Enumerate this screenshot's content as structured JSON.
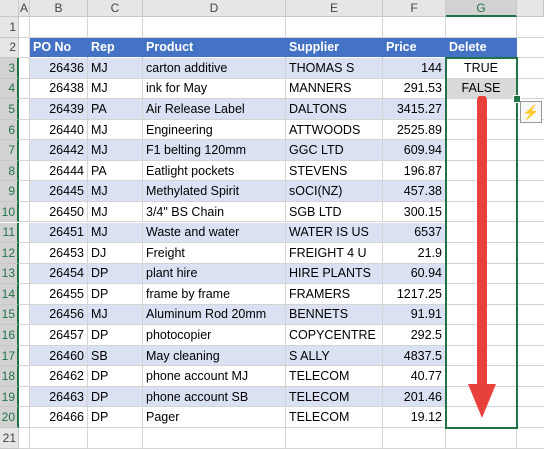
{
  "columns": [
    "A",
    "B",
    "C",
    "D",
    "E",
    "F",
    "G"
  ],
  "selected_column": "G",
  "rows": [
    "1",
    "2",
    "3",
    "4",
    "5",
    "6",
    "7",
    "8",
    "9",
    "10",
    "11",
    "12",
    "13",
    "14",
    "15",
    "16",
    "17",
    "18",
    "19",
    "20",
    "21"
  ],
  "headers": {
    "po": "PO No",
    "rep": "Rep",
    "product": "Product",
    "supplier": "Supplier",
    "price": "Price",
    "delete": "Delete"
  },
  "records": [
    {
      "po": "26436",
      "rep": "MJ",
      "product": "carton additive",
      "supplier": "THOMAS S",
      "price": "144",
      "delete": "TRUE"
    },
    {
      "po": "26438",
      "rep": "MJ",
      "product": "ink for May",
      "supplier": "MANNERS",
      "price": "291.53",
      "delete": "FALSE"
    },
    {
      "po": "26439",
      "rep": "PA",
      "product": "Air Release Label",
      "supplier": "DALTONS",
      "price": "3415.27",
      "delete": ""
    },
    {
      "po": "26440",
      "rep": "MJ",
      "product": "Engineering",
      "supplier": "ATTWOODS",
      "price": "2525.89",
      "delete": ""
    },
    {
      "po": "26442",
      "rep": "MJ",
      "product": "F1 belting 120mm",
      "supplier": "GGC LTD",
      "price": "609.94",
      "delete": ""
    },
    {
      "po": "26444",
      "rep": "PA",
      "product": "Eatlight pockets",
      "supplier": "STEVENS",
      "price": "196.87",
      "delete": ""
    },
    {
      "po": "26445",
      "rep": "MJ",
      "product": "Methylated Spirit",
      "supplier": "sOCI(NZ)",
      "price": "457.38",
      "delete": ""
    },
    {
      "po": "26450",
      "rep": "MJ",
      "product": "3/4\" BS Chain",
      "supplier": "SGB LTD",
      "price": "300.15",
      "delete": ""
    },
    {
      "po": "26451",
      "rep": "MJ",
      "product": "Waste and water",
      "supplier": "WATER IS US",
      "price": "6537",
      "delete": ""
    },
    {
      "po": "26453",
      "rep": "DJ",
      "product": "Freight",
      "supplier": "FREIGHT 4 U",
      "price": "21.9",
      "delete": ""
    },
    {
      "po": "26454",
      "rep": "DP",
      "product": "plant hire",
      "supplier": "HIRE PLANTS",
      "price": "60.94",
      "delete": ""
    },
    {
      "po": "26455",
      "rep": "DP",
      "product": "frame by frame",
      "supplier": "FRAMERS",
      "price": "1217.25",
      "delete": ""
    },
    {
      "po": "26456",
      "rep": "MJ",
      "product": "Aluminum Rod 20mm",
      "supplier": "BENNETS",
      "price": "91.91",
      "delete": ""
    },
    {
      "po": "26457",
      "rep": "DP",
      "product": "photocopier",
      "supplier": "COPYCENTRE",
      "price": "292.5",
      "delete": ""
    },
    {
      "po": "26460",
      "rep": "SB",
      "product": "May cleaning",
      "supplier": "S ALLY",
      "price": "4837.5",
      "delete": ""
    },
    {
      "po": "26462",
      "rep": "DP",
      "product": "phone account MJ",
      "supplier": "TELECOM",
      "price": "40.77",
      "delete": ""
    },
    {
      "po": "26463",
      "rep": "DP",
      "product": "phone account SB",
      "supplier": "TELECOM",
      "price": "201.46",
      "delete": ""
    },
    {
      "po": "26466",
      "rep": "DP",
      "product": "Pager",
      "supplier": "TELECOM",
      "price": "19.12",
      "delete": ""
    }
  ],
  "colors": {
    "header_fill": "#4472c4",
    "band_fill": "#d9e1f2",
    "selection": "#217346",
    "arrow": "#e8413c"
  },
  "icons": {
    "quick_analysis": "quick-analysis-icon",
    "drag_arrow": "down-arrow-icon"
  }
}
